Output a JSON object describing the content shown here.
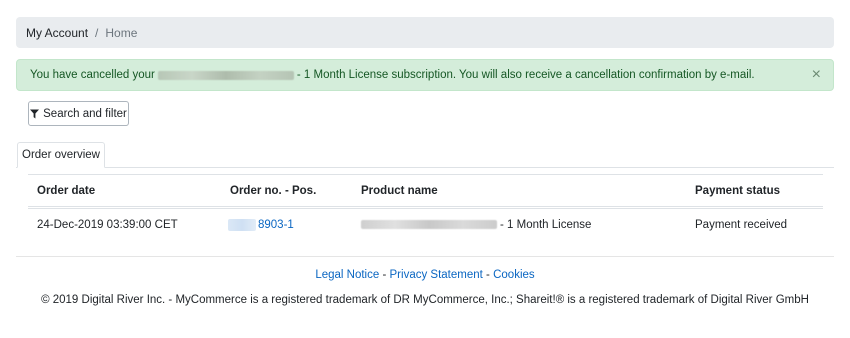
{
  "breadcrumb": {
    "items": [
      "My Account",
      "Home"
    ],
    "separator": "/"
  },
  "alert": {
    "text_before": "You have cancelled your",
    "text_after": "- 1 Month License subscription. You will also receive a cancellation confirmation by e-mail.",
    "close_symbol": "×"
  },
  "toolbar": {
    "filter_label": "Search and filter",
    "filter_icon": "funnel-icon"
  },
  "tabs": [
    {
      "label": "Order overview",
      "active": true
    }
  ],
  "table": {
    "headers": [
      "Order date",
      "Order no. - Pos.",
      "Product name",
      "Payment status"
    ],
    "rows": [
      {
        "order_date": "24-Dec-2019 03:39:00 CET",
        "order_no": "8903-1",
        "product": "- 1 Month License",
        "payment_status": "Payment received"
      }
    ]
  },
  "footer": {
    "links": [
      "Legal Notice",
      "Privacy Statement",
      "Cookies"
    ],
    "separator": "-",
    "copyright": "© 2019 Digital River Inc. - MyCommerce is a registered trademark of DR MyCommerce, Inc.; Shareit!® is a registered trademark of Digital River GmbH"
  },
  "colors": {
    "alert_bg": "#d4edda",
    "alert_text": "#155724",
    "link": "#0a66c2",
    "breadcrumb_bg": "#e9ecef"
  }
}
